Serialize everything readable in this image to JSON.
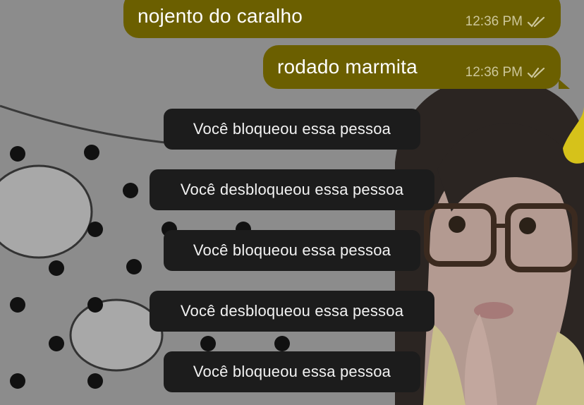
{
  "messages": [
    {
      "text": "nojento do caralho",
      "time": "12:36 PM",
      "status_icon": "double-check-icon"
    },
    {
      "text": "rodado marmita",
      "time": "12:36 PM",
      "status_icon": "double-check-icon"
    }
  ],
  "system_notices": [
    {
      "text": "Você bloqueou essa pessoa"
    },
    {
      "text": "Você desbloqueou essa pessoa"
    },
    {
      "text": "Você bloqueou essa pessoa"
    },
    {
      "text": "Você desbloqueou essa pessoa"
    },
    {
      "text": "Você bloqueou essa pessoa"
    }
  ],
  "colors": {
    "outgoing_bubble": "#6b5f00",
    "system_notice_bg": "#1c1c1c",
    "wallpaper_dim": "#8f8f8f"
  }
}
